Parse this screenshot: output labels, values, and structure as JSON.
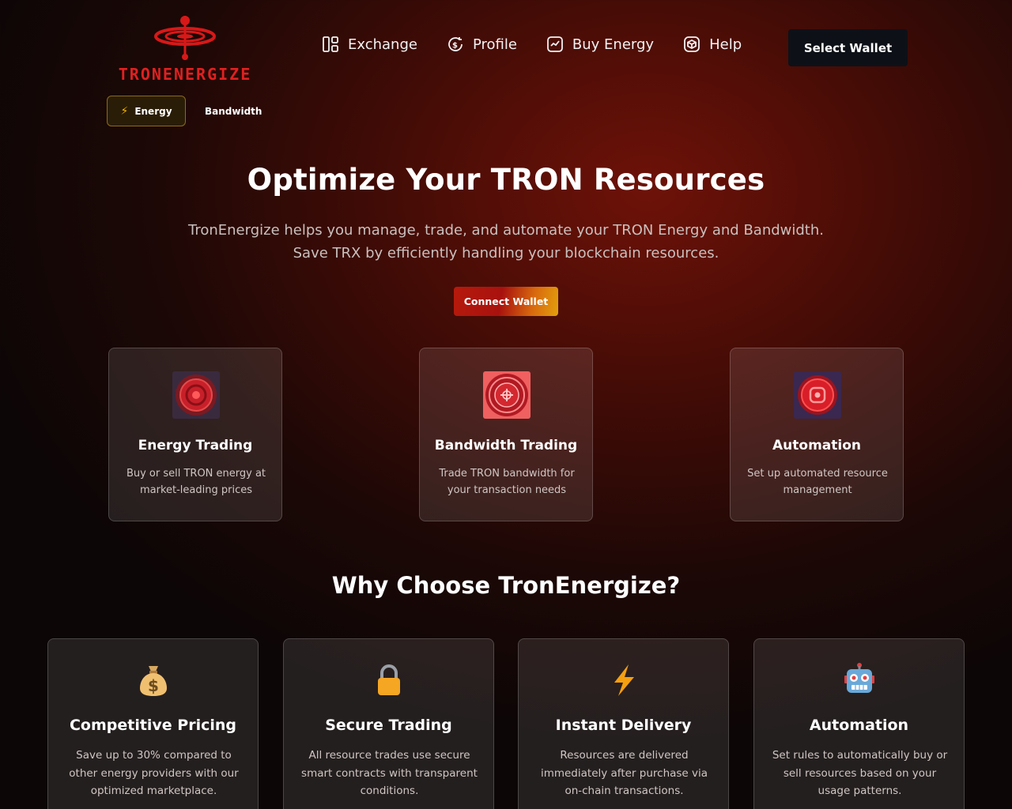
{
  "brand": {
    "name": "TRONENERGIZE",
    "color": "#e02020"
  },
  "nav": {
    "items": [
      {
        "label": "Exchange",
        "icon": "layout-icon"
      },
      {
        "label": "Profile",
        "icon": "dollar-cycle-icon"
      },
      {
        "label": "Buy Energy",
        "icon": "chart-line-icon"
      },
      {
        "label": "Help",
        "icon": "cube-icon"
      }
    ],
    "select_wallet_label": "Select Wallet"
  },
  "tabs": [
    {
      "label": "Energy",
      "icon": "lightning-icon",
      "active": true
    },
    {
      "label": "Bandwidth",
      "active": false
    }
  ],
  "hero": {
    "title": "Optimize Your TRON Resources",
    "subtitle_line1": "TronEnergize helps you manage, trade, and automate your TRON Energy and Bandwidth.",
    "subtitle_line2": "Save TRX by efficiently handling your blockchain resources.",
    "cta_label": "Connect Wallet"
  },
  "features": [
    {
      "title": "Energy Trading",
      "desc": "Buy or sell TRON energy at market-leading prices",
      "icon": "energy-target-icon"
    },
    {
      "title": "Bandwidth Trading",
      "desc": "Trade TRON bandwidth for your transaction needs",
      "icon": "bandwidth-emblem-icon"
    },
    {
      "title": "Automation",
      "desc": "Set up automated resource management",
      "icon": "automation-emblem-icon"
    }
  ],
  "why": {
    "title": "Why Choose TronEnergize?",
    "cards": [
      {
        "title": "Competitive Pricing",
        "desc": "Save up to 30% compared to other energy providers with our optimized marketplace.",
        "icon": "money-bag-icon"
      },
      {
        "title": "Secure Trading",
        "desc": "All resource trades use secure smart contracts with transparent conditions.",
        "icon": "lock-icon"
      },
      {
        "title": "Instant Delivery",
        "desc": "Resources are delivered immediately after purchase via on-chain transactions.",
        "icon": "lightning-icon"
      },
      {
        "title": "Automation",
        "desc": "Set rules to automatically buy or sell resources based on your usage patterns.",
        "icon": "robot-icon"
      }
    ]
  },
  "colors": {
    "accent_red": "#e02020",
    "gold_border": "#8a6a1c",
    "wallet_button_bg": "#0d1117"
  }
}
